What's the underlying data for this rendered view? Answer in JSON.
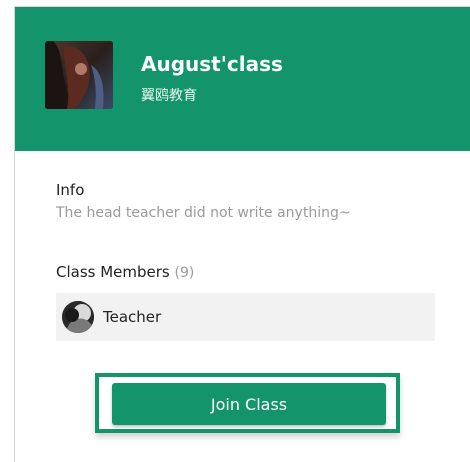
{
  "header": {
    "class_name": "August'class",
    "organization": "翼鸥教育",
    "avatar_icon": "class-avatar-photo"
  },
  "info": {
    "label": "Info",
    "text": "The head teacher did not write anything~"
  },
  "members": {
    "label": "Class Members",
    "count": "(9)",
    "items": [
      {
        "name": "Teacher",
        "avatar_icon": "member-avatar-photo"
      }
    ]
  },
  "actions": {
    "join_label": "Join Class"
  },
  "colors": {
    "brand": "#14946a",
    "muted_text": "#9a9a9a",
    "row_bg": "#f2f2f2"
  }
}
